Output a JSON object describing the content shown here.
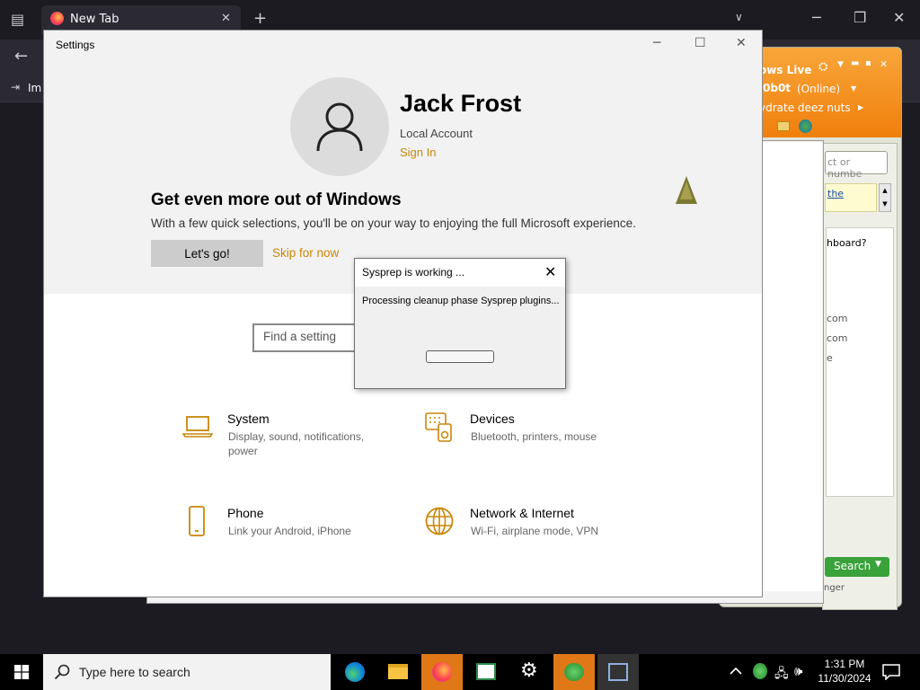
{
  "browser": {
    "tab_title": "New Tab",
    "import_label": "Im"
  },
  "messenger": {
    "title": "ows Live",
    "username": "0b0t",
    "status": "(Online)",
    "personal_message": "ydrate deez nuts",
    "search_placeholder": "ct or numbe",
    "link_text": "the",
    "text_dashboard": "hboard?",
    "text_com1": "com",
    "text_com2": "com",
    "text_e": "e",
    "search_button": "Search",
    "footer_text": "nger"
  },
  "settings": {
    "window_title": "Settings",
    "user_name": "Jack Frost",
    "account_type": "Local Account",
    "sign_in": "Sign In",
    "promo_title": "Get even more out of Windows",
    "promo_desc": "With a few quick selections, you'll be on your way to enjoying the full Microsoft experience.",
    "lets_go": "Let's go!",
    "skip": "Skip for now",
    "find_placeholder": "Find a setting",
    "categories": [
      {
        "name": "System",
        "desc": "Display, sound, notifications, power",
        "icon": "laptop-icon"
      },
      {
        "name": "Devices",
        "desc": "Bluetooth, printers, mouse",
        "icon": "devices-icon"
      },
      {
        "name": "Phone",
        "desc": "Link your Android, iPhone",
        "icon": "phone-icon"
      },
      {
        "name": "Network & Internet",
        "desc": "Wi-Fi, airplane mode, VPN",
        "icon": "globe-icon"
      }
    ]
  },
  "sysprep": {
    "title": "Sysprep is working ...",
    "message": "Processing cleanup phase Sysprep plugins...",
    "progress": 0
  },
  "taskbar": {
    "search_placeholder": "Type here to search",
    "time": "1:31 PM",
    "date": "11/30/2024",
    "accent_color": "#e07818"
  }
}
